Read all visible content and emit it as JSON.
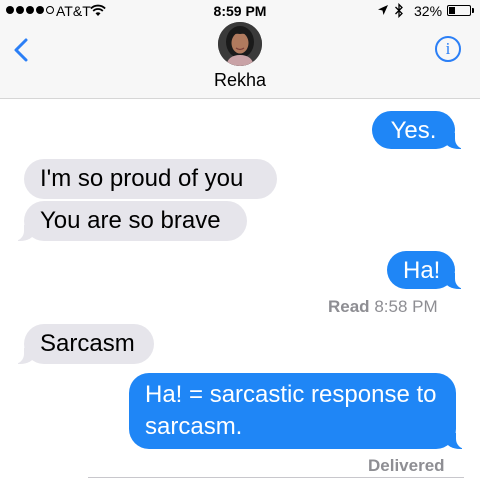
{
  "status_bar": {
    "carrier": "AT&T",
    "time": "8:59 PM",
    "battery_percent_text": "32%",
    "battery_level": 0.32,
    "signal_bars_filled": 4,
    "signal_bars_total": 5,
    "icons": [
      "signal-dots",
      "wifi-icon",
      "location-icon",
      "bluetooth-icon",
      "battery-icon"
    ]
  },
  "header": {
    "contact_name": "Rekha",
    "back_icon": "chevron-left-icon",
    "info_icon_glyph": "i"
  },
  "messages": [
    {
      "direction": "outgoing",
      "text": "Yes."
    },
    {
      "direction": "incoming",
      "text": "I'm so proud of you"
    },
    {
      "direction": "incoming",
      "text": "You are so brave"
    },
    {
      "direction": "outgoing",
      "text": "Ha!"
    },
    {
      "direction": "incoming",
      "text": "Sarcasm"
    },
    {
      "direction": "outgoing",
      "text": "Ha! = sarcastic response to sarcasm."
    }
  ],
  "receipts": {
    "read_label": "Read",
    "read_time": "8:58 PM",
    "delivered": "Delivered"
  },
  "colors": {
    "accent_blue": "#2b7ff6",
    "outgoing_bubble": "#1f86f6",
    "incoming_bubble": "#e6e5eb",
    "receipt_gray": "#8e8e93"
  }
}
